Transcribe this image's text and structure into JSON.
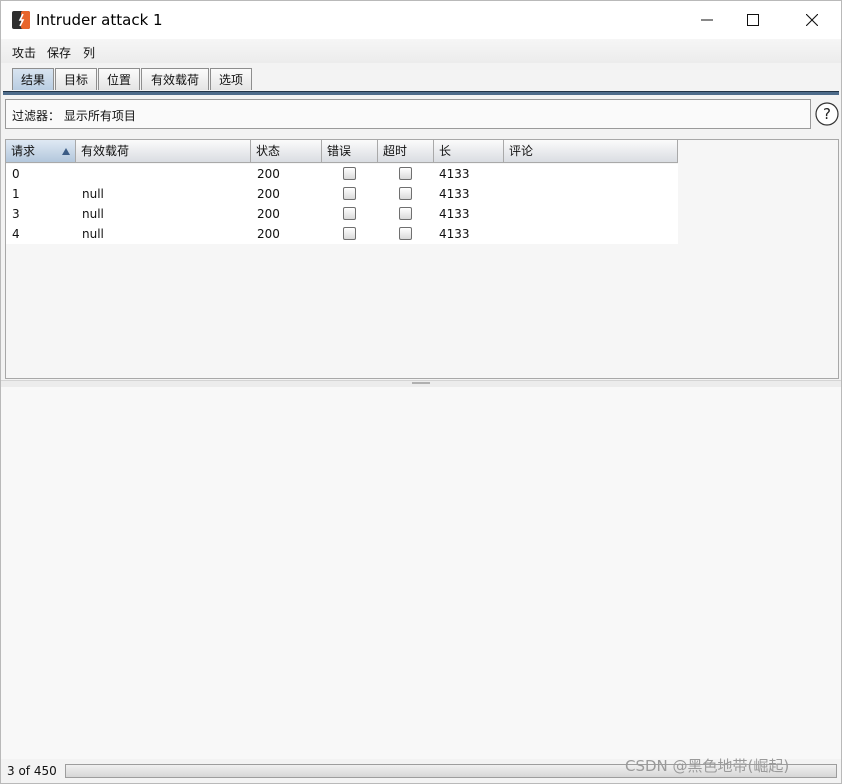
{
  "window": {
    "title": "Intruder attack 1",
    "minimize_icon": "minimize-icon",
    "maximize_icon": "maximize-icon",
    "close_icon": "close-icon"
  },
  "menubar": {
    "items": [
      "攻击",
      "保存",
      "列"
    ]
  },
  "tabs": [
    {
      "label": "结果",
      "active": true
    },
    {
      "label": "目标",
      "active": false
    },
    {
      "label": "位置",
      "active": false
    },
    {
      "label": "有效载荷",
      "active": false
    },
    {
      "label": "选项",
      "active": false
    }
  ],
  "filter": {
    "text": "过滤器： 显示所有项目",
    "help_icon": "help-icon"
  },
  "table": {
    "columns": [
      "请求",
      "有效载荷",
      "状态",
      "错误",
      "超时",
      "长",
      "评论"
    ],
    "sorted_column": "请求",
    "rows": [
      {
        "request": "0",
        "payload": "",
        "status": "200",
        "error": false,
        "timeout": false,
        "length": "4133",
        "comment": ""
      },
      {
        "request": "1",
        "payload": "null",
        "status": "200",
        "error": false,
        "timeout": false,
        "length": "4133",
        "comment": ""
      },
      {
        "request": "3",
        "payload": "null",
        "status": "200",
        "error": false,
        "timeout": false,
        "length": "4133",
        "comment": ""
      },
      {
        "request": "4",
        "payload": "null",
        "status": "200",
        "error": false,
        "timeout": false,
        "length": "4133",
        "comment": ""
      }
    ]
  },
  "status": {
    "progress_text": "3 of 450"
  },
  "watermark": "CSDN @黑色地带(崛起)",
  "colors": {
    "active_tab": "#b9cde2",
    "tab_rule": "#4d6b8a",
    "sort_arrow": "#3b5c85"
  }
}
